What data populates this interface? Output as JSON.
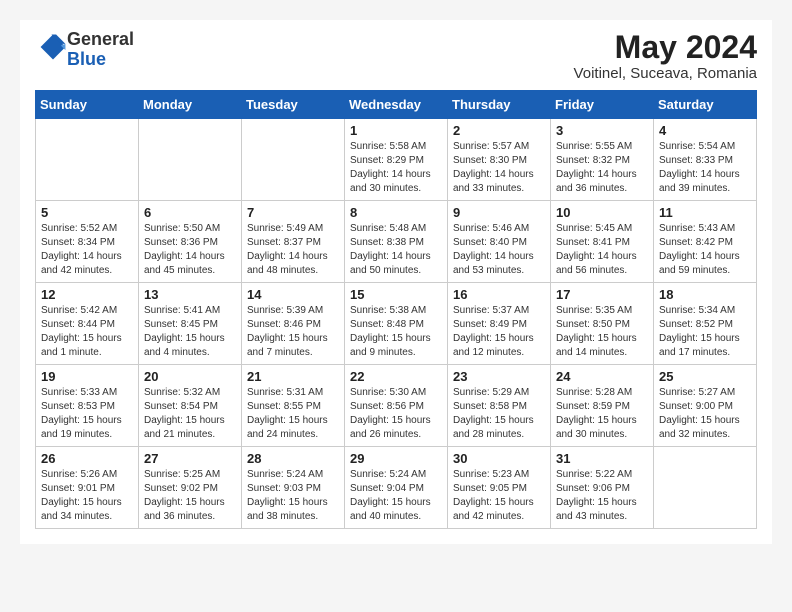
{
  "header": {
    "logo_general": "General",
    "logo_blue": "Blue",
    "month_year": "May 2024",
    "location": "Voitinel, Suceava, Romania"
  },
  "days_of_week": [
    "Sunday",
    "Monday",
    "Tuesday",
    "Wednesday",
    "Thursday",
    "Friday",
    "Saturday"
  ],
  "weeks": [
    {
      "cells": [
        {
          "day": "",
          "info": ""
        },
        {
          "day": "",
          "info": ""
        },
        {
          "day": "",
          "info": ""
        },
        {
          "day": "1",
          "info": "Sunrise: 5:58 AM\nSunset: 8:29 PM\nDaylight: 14 hours\nand 30 minutes."
        },
        {
          "day": "2",
          "info": "Sunrise: 5:57 AM\nSunset: 8:30 PM\nDaylight: 14 hours\nand 33 minutes."
        },
        {
          "day": "3",
          "info": "Sunrise: 5:55 AM\nSunset: 8:32 PM\nDaylight: 14 hours\nand 36 minutes."
        },
        {
          "day": "4",
          "info": "Sunrise: 5:54 AM\nSunset: 8:33 PM\nDaylight: 14 hours\nand 39 minutes."
        }
      ]
    },
    {
      "cells": [
        {
          "day": "5",
          "info": "Sunrise: 5:52 AM\nSunset: 8:34 PM\nDaylight: 14 hours\nand 42 minutes."
        },
        {
          "day": "6",
          "info": "Sunrise: 5:50 AM\nSunset: 8:36 PM\nDaylight: 14 hours\nand 45 minutes."
        },
        {
          "day": "7",
          "info": "Sunrise: 5:49 AM\nSunset: 8:37 PM\nDaylight: 14 hours\nand 48 minutes."
        },
        {
          "day": "8",
          "info": "Sunrise: 5:48 AM\nSunset: 8:38 PM\nDaylight: 14 hours\nand 50 minutes."
        },
        {
          "day": "9",
          "info": "Sunrise: 5:46 AM\nSunset: 8:40 PM\nDaylight: 14 hours\nand 53 minutes."
        },
        {
          "day": "10",
          "info": "Sunrise: 5:45 AM\nSunset: 8:41 PM\nDaylight: 14 hours\nand 56 minutes."
        },
        {
          "day": "11",
          "info": "Sunrise: 5:43 AM\nSunset: 8:42 PM\nDaylight: 14 hours\nand 59 minutes."
        }
      ]
    },
    {
      "cells": [
        {
          "day": "12",
          "info": "Sunrise: 5:42 AM\nSunset: 8:44 PM\nDaylight: 15 hours\nand 1 minute."
        },
        {
          "day": "13",
          "info": "Sunrise: 5:41 AM\nSunset: 8:45 PM\nDaylight: 15 hours\nand 4 minutes."
        },
        {
          "day": "14",
          "info": "Sunrise: 5:39 AM\nSunset: 8:46 PM\nDaylight: 15 hours\nand 7 minutes."
        },
        {
          "day": "15",
          "info": "Sunrise: 5:38 AM\nSunset: 8:48 PM\nDaylight: 15 hours\nand 9 minutes."
        },
        {
          "day": "16",
          "info": "Sunrise: 5:37 AM\nSunset: 8:49 PM\nDaylight: 15 hours\nand 12 minutes."
        },
        {
          "day": "17",
          "info": "Sunrise: 5:35 AM\nSunset: 8:50 PM\nDaylight: 15 hours\nand 14 minutes."
        },
        {
          "day": "18",
          "info": "Sunrise: 5:34 AM\nSunset: 8:52 PM\nDaylight: 15 hours\nand 17 minutes."
        }
      ]
    },
    {
      "cells": [
        {
          "day": "19",
          "info": "Sunrise: 5:33 AM\nSunset: 8:53 PM\nDaylight: 15 hours\nand 19 minutes."
        },
        {
          "day": "20",
          "info": "Sunrise: 5:32 AM\nSunset: 8:54 PM\nDaylight: 15 hours\nand 21 minutes."
        },
        {
          "day": "21",
          "info": "Sunrise: 5:31 AM\nSunset: 8:55 PM\nDaylight: 15 hours\nand 24 minutes."
        },
        {
          "day": "22",
          "info": "Sunrise: 5:30 AM\nSunset: 8:56 PM\nDaylight: 15 hours\nand 26 minutes."
        },
        {
          "day": "23",
          "info": "Sunrise: 5:29 AM\nSunset: 8:58 PM\nDaylight: 15 hours\nand 28 minutes."
        },
        {
          "day": "24",
          "info": "Sunrise: 5:28 AM\nSunset: 8:59 PM\nDaylight: 15 hours\nand 30 minutes."
        },
        {
          "day": "25",
          "info": "Sunrise: 5:27 AM\nSunset: 9:00 PM\nDaylight: 15 hours\nand 32 minutes."
        }
      ]
    },
    {
      "cells": [
        {
          "day": "26",
          "info": "Sunrise: 5:26 AM\nSunset: 9:01 PM\nDaylight: 15 hours\nand 34 minutes."
        },
        {
          "day": "27",
          "info": "Sunrise: 5:25 AM\nSunset: 9:02 PM\nDaylight: 15 hours\nand 36 minutes."
        },
        {
          "day": "28",
          "info": "Sunrise: 5:24 AM\nSunset: 9:03 PM\nDaylight: 15 hours\nand 38 minutes."
        },
        {
          "day": "29",
          "info": "Sunrise: 5:24 AM\nSunset: 9:04 PM\nDaylight: 15 hours\nand 40 minutes."
        },
        {
          "day": "30",
          "info": "Sunrise: 5:23 AM\nSunset: 9:05 PM\nDaylight: 15 hours\nand 42 minutes."
        },
        {
          "day": "31",
          "info": "Sunrise: 5:22 AM\nSunset: 9:06 PM\nDaylight: 15 hours\nand 43 minutes."
        },
        {
          "day": "",
          "info": ""
        }
      ]
    }
  ]
}
